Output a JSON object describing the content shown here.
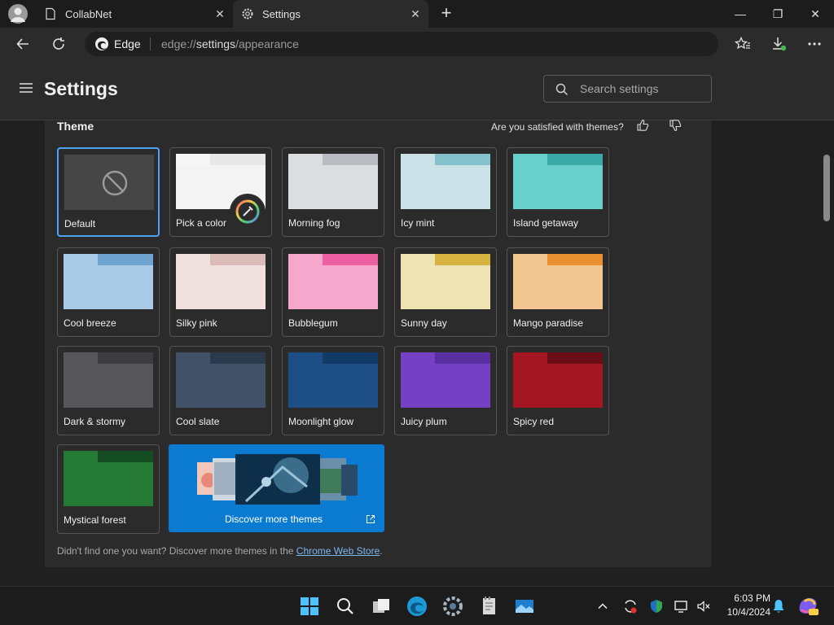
{
  "browser": {
    "tabs": [
      {
        "label": "CollabNet",
        "close": "✕"
      },
      {
        "label": "Settings",
        "close": "✕"
      }
    ],
    "new_tab": "+",
    "window_controls": {
      "minimize": "—",
      "maximize": "❐",
      "close": "✕"
    },
    "address": {
      "brand": "Edge",
      "url_prefix": "edge://",
      "url_highlight": "settings",
      "url_suffix": "/appearance"
    }
  },
  "header": {
    "title": "Settings",
    "search_placeholder": "Search settings"
  },
  "theme_section": {
    "heading": "Theme",
    "feedback_question": "Are you satisfied with themes?",
    "tiles": [
      {
        "label": "Default",
        "top": "#464646",
        "tab": "#464646",
        "body": "#464646",
        "selected": true
      },
      {
        "label": "Pick a color",
        "top": "#e8e8e8",
        "tab": "#f6f6f6",
        "body": "#f4f4f4"
      },
      {
        "label": "Morning fog",
        "top": "#b9bcc1",
        "tab": "#dcdde0",
        "body": "#dcdde0"
      },
      {
        "label": "Icy mint",
        "top": "#86c2cb",
        "tab": "#cbe3e8",
        "body": "#cbe3e8"
      },
      {
        "label": "Island getaway",
        "top": "#3aa9a7",
        "tab": "#68cfcd",
        "body": "#68cfcd"
      },
      {
        "label": "Cool breeze",
        "top": "#6ea4cf",
        "tab": "#a9cbe7",
        "body": "#a9cbe7"
      },
      {
        "label": "Silky pink",
        "top": "#dcbcb8",
        "tab": "#f1e1de",
        "body": "#f1e1de"
      },
      {
        "label": "Bubblegum",
        "top": "#ec5fa0",
        "tab": "#f6a8cc",
        "body": "#f6a8cc"
      },
      {
        "label": "Sunny day",
        "top": "#d6b341",
        "tab": "#eee3b3",
        "body": "#eee3b3"
      },
      {
        "label": "Mango paradise",
        "top": "#e88f30",
        "tab": "#f2c690",
        "body": "#f2c690"
      },
      {
        "label": "Dark & stormy",
        "top": "#3d3d41",
        "tab": "#56565b",
        "body": "#56565b"
      },
      {
        "label": "Cool slate",
        "top": "#2b3a4d",
        "tab": "#415167",
        "body": "#415167"
      },
      {
        "label": "Moonlight glow",
        "top": "#123a66",
        "tab": "#1e4e86",
        "body": "#1e4e86"
      },
      {
        "label": "Juicy plum",
        "top": "#5a2fa2",
        "tab": "#7640c4",
        "body": "#7640c4"
      },
      {
        "label": "Spicy red",
        "top": "#6b0d14",
        "tab": "#a41621",
        "body": "#a41621"
      },
      {
        "label": "Mystical forest",
        "top": "#154d22",
        "tab": "#247a35",
        "body": "#247a35"
      }
    ],
    "discover_label": "Discover more themes",
    "footer_text": "Didn't find one you want? Discover more themes in the ",
    "footer_link": "Chrome Web Store",
    "footer_end": "."
  },
  "taskbar": {
    "time": "6:03 PM",
    "date": "10/4/2024"
  },
  "colors": {
    "accent": "#4ea2f0",
    "discover_bg": "#0b7ad1"
  }
}
